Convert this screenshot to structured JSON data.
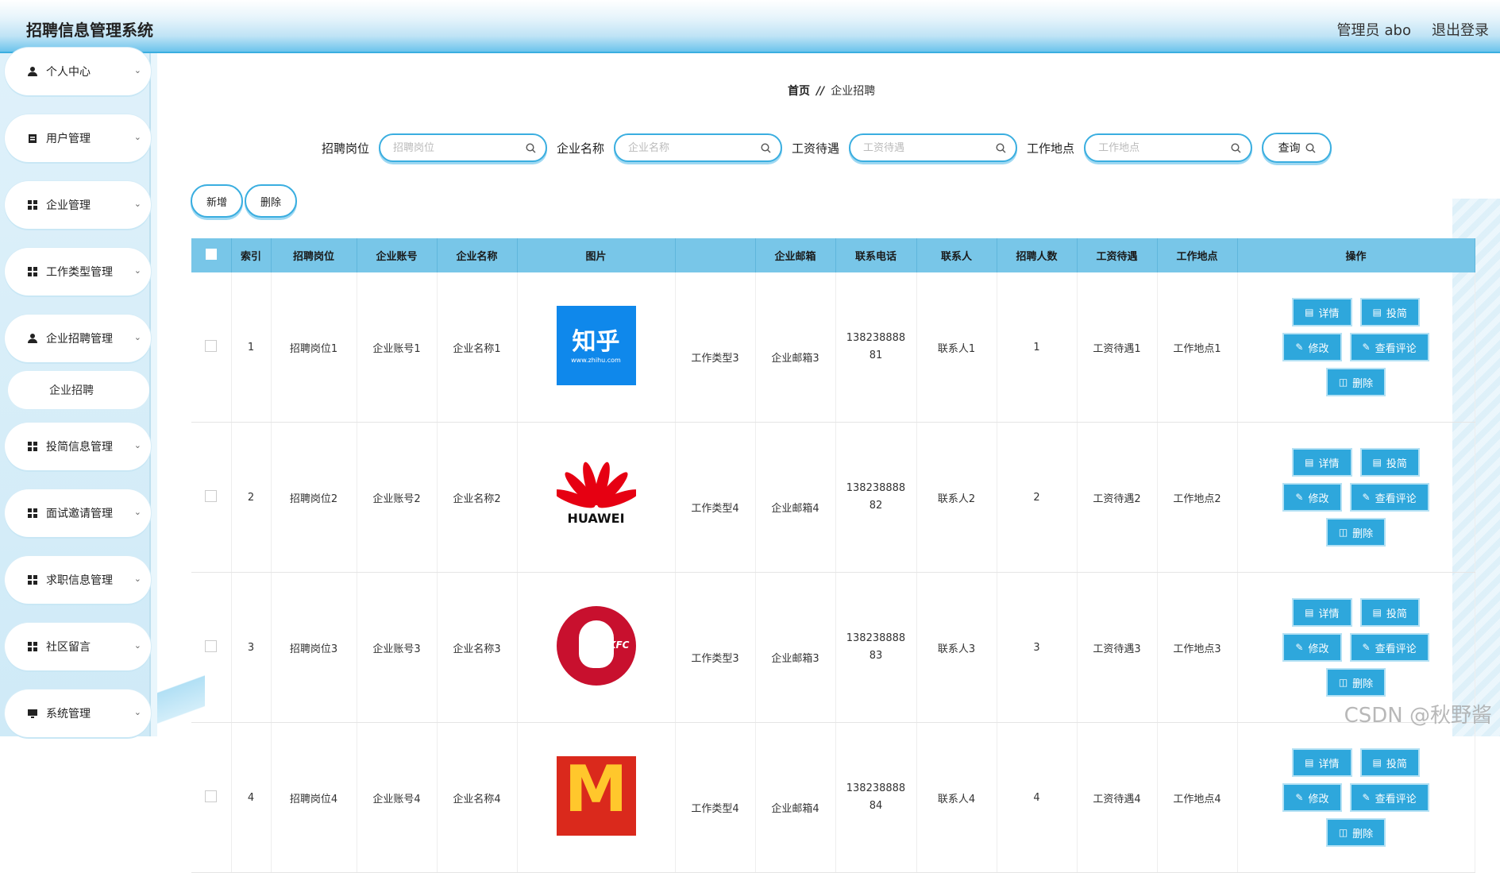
{
  "app": {
    "title": "招聘信息管理系统"
  },
  "header": {
    "role": "管理员",
    "username": "abo",
    "logout": "退出登录"
  },
  "sidebar": {
    "items": [
      {
        "label": "个人中心",
        "icon": "user-icon"
      },
      {
        "label": "用户管理",
        "icon": "clipboard-icon"
      },
      {
        "label": "企业管理",
        "icon": "grid-icon"
      },
      {
        "label": "工作类型管理",
        "icon": "grid-icon"
      },
      {
        "label": "企业招聘管理",
        "icon": "user-icon"
      },
      {
        "label": "投简信息管理",
        "icon": "grid-icon"
      },
      {
        "label": "面试邀请管理",
        "icon": "grid-icon"
      },
      {
        "label": "求职信息管理",
        "icon": "grid-icon"
      },
      {
        "label": "社区留言",
        "icon": "grid-icon"
      },
      {
        "label": "系统管理",
        "icon": "monitor-icon"
      }
    ],
    "submenu": {
      "label": "企业招聘"
    }
  },
  "breadcrumb": {
    "home": "首页",
    "separator": "//",
    "current": "企业招聘"
  },
  "search": {
    "fields": [
      {
        "label": "招聘岗位",
        "placeholder": "招聘岗位"
      },
      {
        "label": "企业名称",
        "placeholder": "企业名称"
      },
      {
        "label": "工资待遇",
        "placeholder": "工资待遇"
      },
      {
        "label": "工作地点",
        "placeholder": "工作地点"
      }
    ],
    "button": "查询"
  },
  "actions": {
    "add": "新增",
    "delete": "删除"
  },
  "table": {
    "columns": [
      "索引",
      "招聘岗位",
      "企业账号",
      "企业名称",
      "图片",
      "",
      "企业邮箱",
      "联系电话",
      "联系人",
      "招聘人数",
      "工资待遇",
      "工作地点",
      "操作"
    ],
    "rows": [
      {
        "index": "1",
        "position": "招聘岗位1",
        "account": "企业账号1",
        "company": "企业名称1",
        "logo": "zhihu",
        "logo_text": "知乎",
        "logo_sub": "www.zhihu.com",
        "job_type": "工作类型3",
        "email": "企业邮箱3",
        "phone": "13823888881",
        "contact": "联系人1",
        "headcount": "1",
        "salary": "工资待遇1",
        "location": "工作地点1"
      },
      {
        "index": "2",
        "position": "招聘岗位2",
        "account": "企业账号2",
        "company": "企业名称2",
        "logo": "huawei",
        "logo_text": "HUAWEI",
        "job_type": "工作类型4",
        "email": "企业邮箱4",
        "phone": "13823888882",
        "contact": "联系人2",
        "headcount": "2",
        "salary": "工资待遇2",
        "location": "工作地点2"
      },
      {
        "index": "3",
        "position": "招聘岗位3",
        "account": "企业账号3",
        "company": "企业名称3",
        "logo": "kfc",
        "logo_text": "KFC",
        "job_type": "工作类型3",
        "email": "企业邮箱3",
        "phone": "13823888883",
        "contact": "联系人3",
        "headcount": "3",
        "salary": "工资待遇3",
        "location": "工作地点3"
      },
      {
        "index": "4",
        "position": "招聘岗位4",
        "account": "企业账号4",
        "company": "企业名称4",
        "logo": "mcdonalds",
        "logo_text": "M",
        "job_type": "工作类型4",
        "email": "企业邮箱4",
        "phone": "13823888884",
        "contact": "联系人4",
        "headcount": "4",
        "salary": "工资待遇4",
        "location": "工作地点4"
      }
    ],
    "row_actions": {
      "detail": "详情",
      "submit": "投简",
      "edit": "修改",
      "comments": "查看评论",
      "delete": "删除"
    }
  },
  "watermark": "CSDN @秋野酱",
  "colors": {
    "accent": "#2ea7dc",
    "header_bg": "#78c6e8",
    "border": "#3aaee0"
  }
}
